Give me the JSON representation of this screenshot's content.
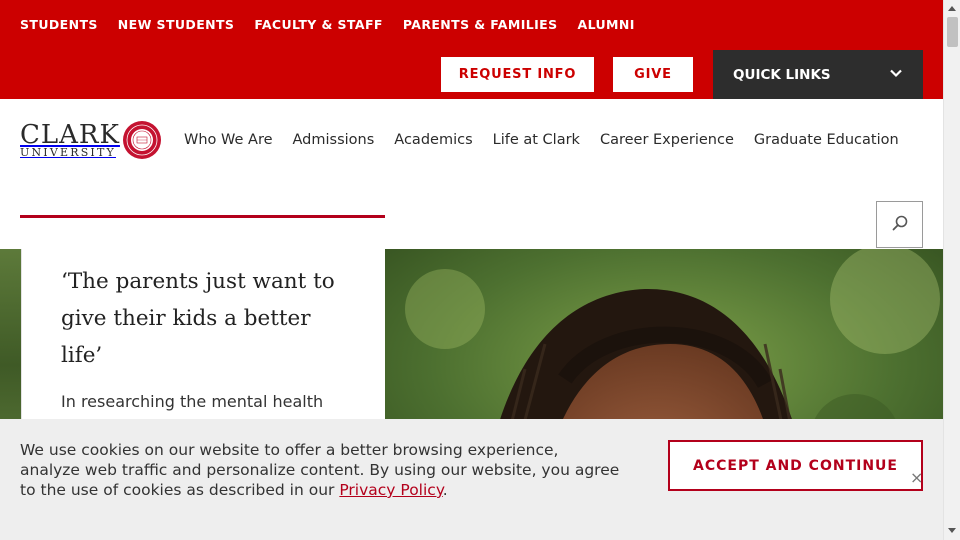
{
  "audience_nav": {
    "items": [
      {
        "label": "STUDENTS"
      },
      {
        "label": "NEW STUDENTS"
      },
      {
        "label": "FACULTY & STAFF"
      },
      {
        "label": "PARENTS & FAMILIES"
      },
      {
        "label": "ALUMNI"
      }
    ]
  },
  "utility": {
    "request_info": "REQUEST INFO",
    "give": "GIVE",
    "quick_links": "QUICK LINKS",
    "quick_links_icon": "chevron-down-icon"
  },
  "brand": {
    "name_line1": "CLARK",
    "name_line2": "UNIVERSITY",
    "seal_icon": "university-seal"
  },
  "main_nav": {
    "items": [
      {
        "label": "Who We Are"
      },
      {
        "label": "Admissions"
      },
      {
        "label": "Academics"
      },
      {
        "label": "Life at Clark"
      },
      {
        "label": "Career Experience"
      },
      {
        "label": "Graduate Education"
      }
    ],
    "search_icon": "search-icon"
  },
  "hero": {
    "title": "‘The parents just want to give their kids a better life’",
    "text": "In researching the mental health challenges faced by Caribbean"
  },
  "cookie_banner": {
    "message": "We use cookies on our website to offer a better browsing experience, analyze web traffic and personalize content. By using our website, you agree to the use of cookies as described in our",
    "link_text": "Privacy Policy",
    "trailing": ".",
    "accept_label": "ACCEPT AND CONTINUE",
    "close_icon": "close-icon"
  },
  "colors": {
    "brand_red": "#cc0000",
    "dark": "#2d2d2d",
    "accent_red": "#b3001b",
    "banner_bg": "#eeeeee"
  }
}
